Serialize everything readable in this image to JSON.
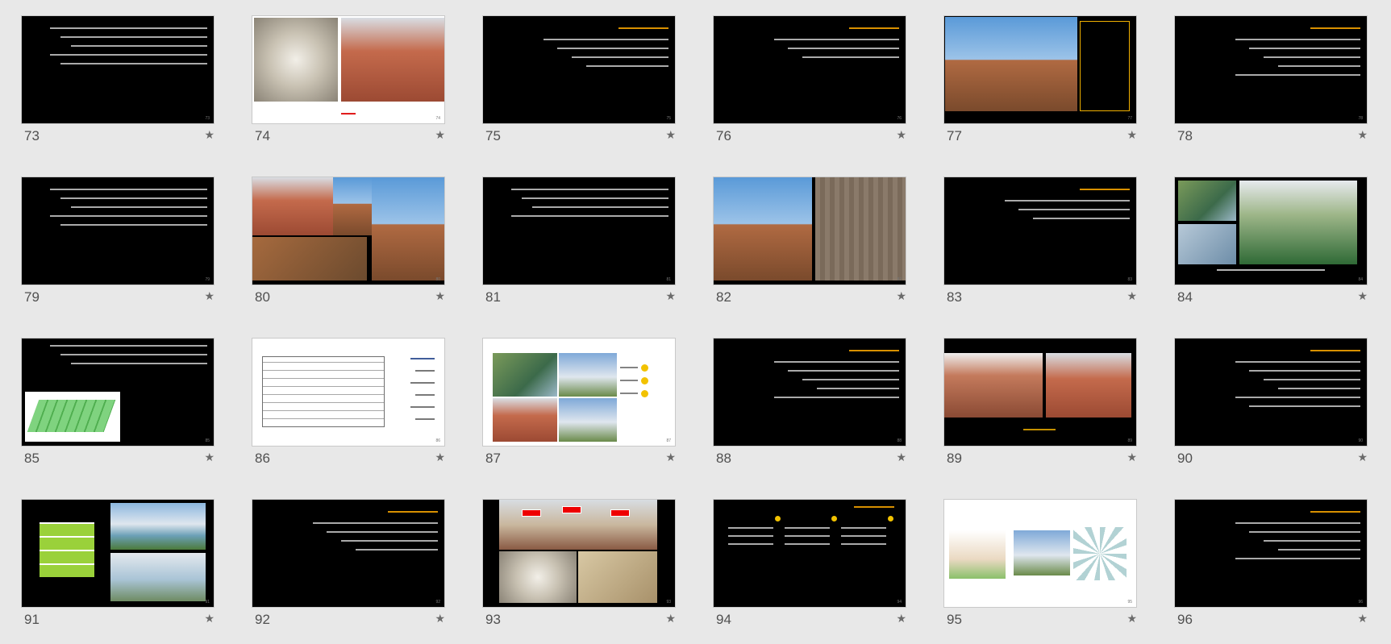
{
  "slides": [
    {
      "number": "73",
      "layout": "text",
      "lines": 5
    },
    {
      "number": "74",
      "layout": "photos-white",
      "caption": ""
    },
    {
      "number": "75",
      "layout": "text-title",
      "lines": 4
    },
    {
      "number": "76",
      "layout": "text-title",
      "lines": 3
    },
    {
      "number": "77",
      "layout": "photo-text",
      "lines": 0
    },
    {
      "number": "78",
      "layout": "text-title",
      "lines": 5
    },
    {
      "number": "79",
      "layout": "text",
      "lines": 5
    },
    {
      "number": "80",
      "layout": "photo-collage",
      "lines": 0
    },
    {
      "number": "81",
      "layout": "text",
      "lines": 4
    },
    {
      "number": "82",
      "layout": "photo-two",
      "lines": 0
    },
    {
      "number": "83",
      "layout": "text-title",
      "lines": 3
    },
    {
      "number": "84",
      "layout": "photo-aerial",
      "lines": 0
    },
    {
      "number": "85",
      "layout": "text-render",
      "lines": 3
    },
    {
      "number": "86",
      "layout": "plan-white",
      "lines": 0
    },
    {
      "number": "87",
      "layout": "photos-list-white",
      "lines": 0
    },
    {
      "number": "88",
      "layout": "text-title",
      "lines": 5
    },
    {
      "number": "89",
      "layout": "photo-gate",
      "lines": 0
    },
    {
      "number": "90",
      "layout": "text-title",
      "lines": 6
    },
    {
      "number": "91",
      "layout": "garden",
      "lines": 0
    },
    {
      "number": "92",
      "layout": "text-title",
      "lines": 4
    },
    {
      "number": "93",
      "layout": "photo-taj-labels",
      "lines": 0
    },
    {
      "number": "94",
      "layout": "three-columns",
      "lines": 0
    },
    {
      "number": "95",
      "layout": "drawings-white",
      "lines": 0
    },
    {
      "number": "96",
      "layout": "text-title",
      "lines": 5
    }
  ],
  "star_icon": "☆"
}
